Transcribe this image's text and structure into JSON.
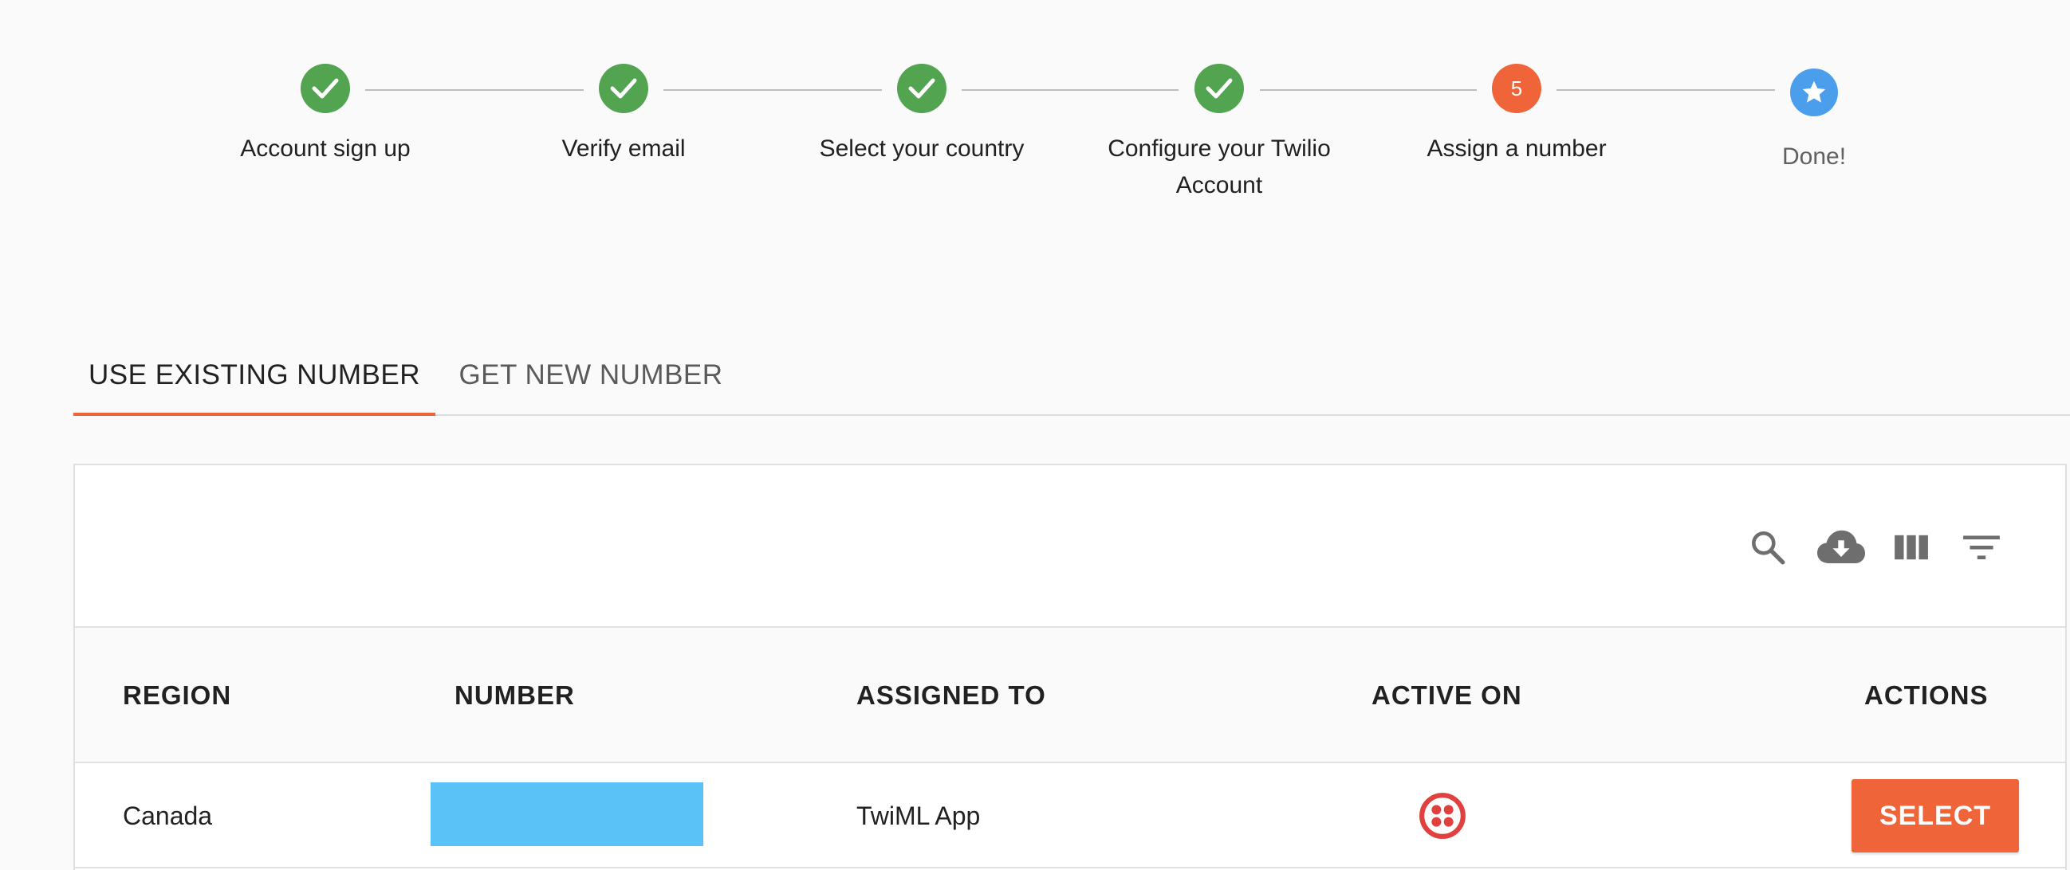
{
  "stepper": {
    "steps": [
      {
        "label": "Account sign up",
        "state": "done"
      },
      {
        "label": "Verify email",
        "state": "done"
      },
      {
        "label": "Select your country",
        "state": "done"
      },
      {
        "label": "Configure your Twilio Account",
        "state": "done"
      },
      {
        "label": "Assign a number",
        "state": "active",
        "number": "5"
      },
      {
        "label": "Done!",
        "state": "pending",
        "icon": "star-icon"
      }
    ]
  },
  "tabs": [
    {
      "label": "USE EXISTING NUMBER",
      "active": true
    },
    {
      "label": "GET NEW NUMBER",
      "active": false
    }
  ],
  "toolbar": {
    "icons": [
      "search-icon",
      "cloud-download-icon",
      "view-columns-icon",
      "filter-list-icon"
    ]
  },
  "table": {
    "columns": [
      "REGION",
      "NUMBER",
      "ASSIGNED TO",
      "ACTIVE ON",
      "ACTIONS"
    ],
    "rows": [
      {
        "region": "Canada",
        "number": "",
        "assigned_to": "TwiML App",
        "active_on_icon": "twilio-logo-icon",
        "action_label": "SELECT"
      }
    ]
  },
  "colors": {
    "accent": "#ef6438",
    "success": "#53a451",
    "info": "#4b9eec",
    "redaction": "#5bc2f7",
    "twilio_red": "#e0413f"
  }
}
